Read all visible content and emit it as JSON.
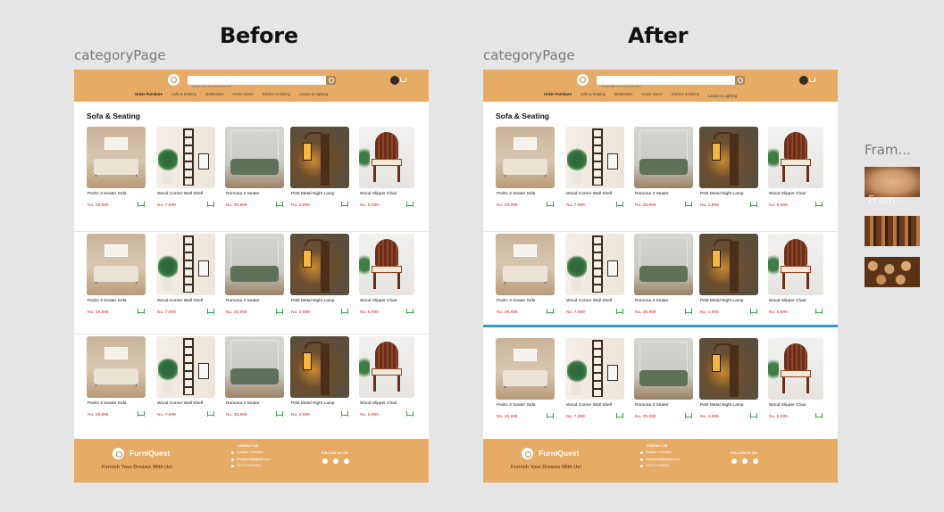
{
  "headings": {
    "before": "Before",
    "after": "After"
  },
  "frame_label": "categoryPage",
  "header": {
    "search_placeholder": "What are you looking for?",
    "nav": [
      "Order Furniture",
      "Sofa & Seating",
      "Mattresses",
      "Home Decor",
      "Kitchen & Dining",
      "Lamps & Lighting"
    ]
  },
  "category_title": "Sofa & Seating",
  "products": [
    {
      "name": "Pedro 3 Seater Sofa",
      "price": "Nu. 29,999"
    },
    {
      "name": "Wood Corner Wall Shelf",
      "price": "Nu. 7,999"
    },
    {
      "name": "Romona 3 Seater",
      "price": "Nu. 35,999"
    },
    {
      "name": "Petit Metal Night Lamp",
      "price": "Nu. 3,999"
    },
    {
      "name": "Wood Slipper Chair",
      "price": "Nu. 5,999"
    }
  ],
  "footer": {
    "brand": "FurniQuest",
    "tagline": "Furnish Your Dreams With Us!",
    "contact_title": "CONTACT US",
    "address": "Kabjisa, Thimphu",
    "email": "furniquest@gmail.com",
    "phone": "+975 17234423",
    "follow_title": "FOLLOW US ON"
  },
  "side_panel": {
    "label": "Fram...",
    "overlay": "Fram..."
  },
  "colors": {
    "accent": "#e6ac66",
    "price": "#dd2222",
    "cart": "#3aa24a",
    "selection": "#2d9cdb"
  }
}
